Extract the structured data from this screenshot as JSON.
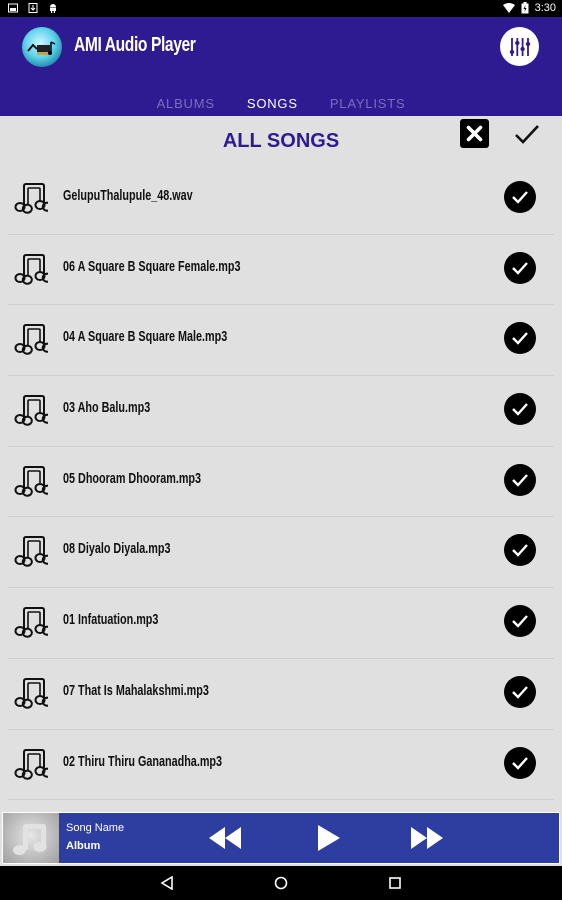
{
  "status_bar": {
    "left_icons": [
      "image-icon",
      "download-icon",
      "android-icon"
    ],
    "right_icons": [
      "wifi-icon",
      "battery-icon"
    ],
    "time": "3:30"
  },
  "app_bar": {
    "title": "AMI Audio Player",
    "logo": "ami-audio-logo",
    "action_icon": "equalizer-icon",
    "brand_color": "#2e1a91"
  },
  "tabs": [
    {
      "label": "ALBUMS",
      "active": false
    },
    {
      "label": "SONGS",
      "active": true
    },
    {
      "label": "PLAYLISTS",
      "active": false
    }
  ],
  "header": {
    "title": "ALL SONGS",
    "close_icon": "close-icon",
    "confirm_icon": "check-icon"
  },
  "songs": [
    {
      "name": "GelupuThalupule_48.wav",
      "selected": true
    },
    {
      "name": "06  A Square B Square Female.mp3",
      "selected": true
    },
    {
      "name": "04  A Square B Square Male.mp3",
      "selected": true
    },
    {
      "name": "03  Aho Balu.mp3",
      "selected": true
    },
    {
      "name": "05  Dhooram Dhooram.mp3",
      "selected": true
    },
    {
      "name": "08  Diyalo Diyala.mp3",
      "selected": true
    },
    {
      "name": "01  Infatuation.mp3",
      "selected": true
    },
    {
      "name": "07  That Is Mahalakshmi.mp3",
      "selected": true
    },
    {
      "name": "02  Thiru Thiru Gananadha.mp3",
      "selected": true
    }
  ],
  "player": {
    "song_name": "Song Name",
    "album": "Album",
    "controls": [
      "rewind-icon",
      "play-icon",
      "fast-forward-icon"
    ],
    "color": "#2e3ea0"
  },
  "nav_bar": {
    "buttons": [
      "back-icon",
      "home-icon",
      "recents-icon"
    ]
  }
}
